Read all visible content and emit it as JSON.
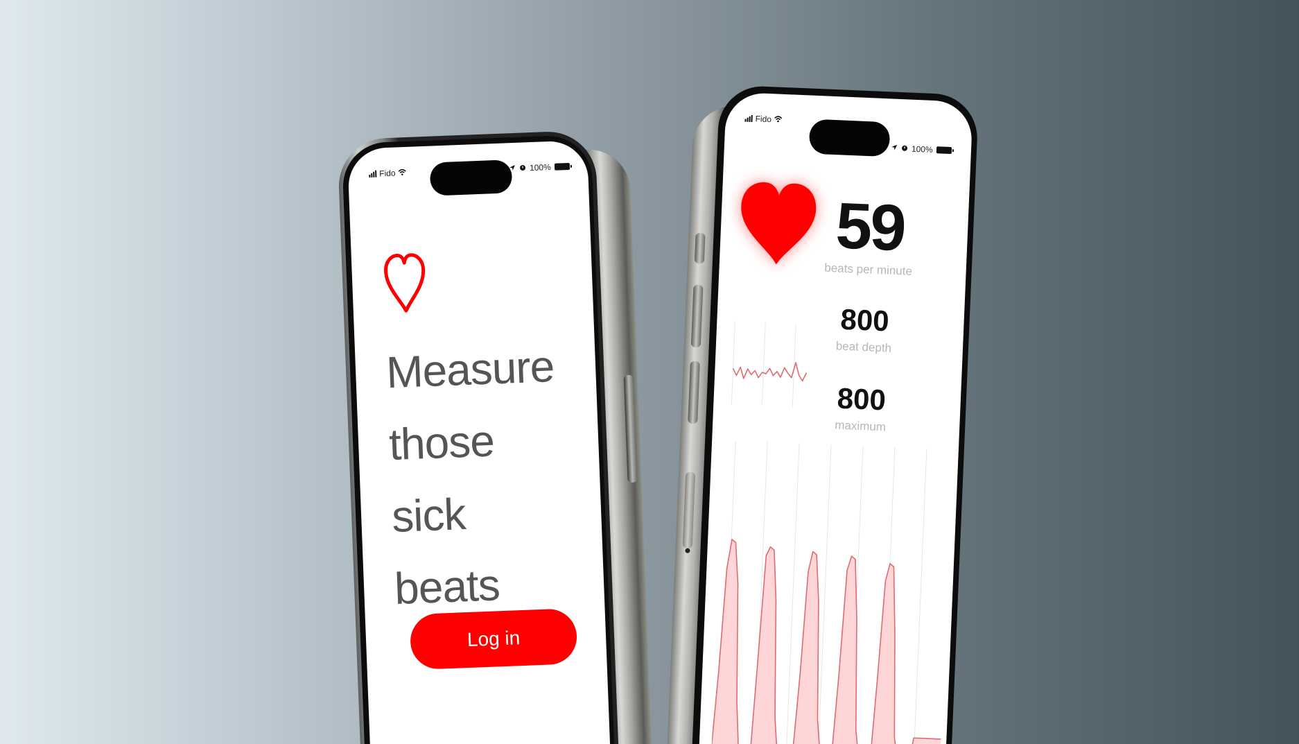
{
  "status_bar": {
    "carrier": "Fido",
    "battery": "100%",
    "icons": [
      "signal-icon",
      "wifi-icon",
      "location-icon",
      "alarm-icon",
      "battery-icon"
    ]
  },
  "left_screen": {
    "headline": [
      "Measure",
      "those",
      "sick",
      "beats"
    ],
    "login_label": "Log in",
    "icons": [
      "heart-outline-icon"
    ]
  },
  "right_screen": {
    "bpm": {
      "value": "59",
      "label": "beats per minute"
    },
    "depth": {
      "value": "800",
      "label": "beat depth"
    },
    "maximum": {
      "value": "800",
      "label": "maximum"
    },
    "icons": [
      "heart-filled-icon"
    ]
  },
  "colors": {
    "accent": "#ff0000",
    "chart_fill": "#ffd6d8",
    "chart_line": "#e06a70",
    "grid": "#e6e6e6"
  },
  "chart_data": [
    {
      "type": "line",
      "x": [
        0,
        1,
        2,
        3,
        4,
        5,
        6,
        7,
        8,
        9,
        10,
        11,
        12,
        13,
        14,
        15,
        16,
        17,
        18,
        19,
        20
      ],
      "values": [
        0.55,
        0.3,
        0.6,
        0.2,
        0.55,
        0.35,
        0.5,
        0.25,
        0.45,
        0.4,
        0.6,
        0.35,
        0.5,
        0.3,
        0.65,
        0.45,
        0.3,
        0.85,
        0.4,
        0.2,
        0.5
      ]
    },
    {
      "type": "area",
      "x": [
        0,
        1,
        2,
        3,
        4,
        5,
        6,
        7,
        8,
        9,
        10,
        11,
        12,
        13,
        14,
        15,
        16,
        17,
        18,
        19,
        20,
        21,
        22,
        23,
        24,
        25,
        26,
        27,
        28,
        29,
        30,
        31,
        32,
        33,
        34,
        35,
        36,
        37,
        38,
        39,
        40,
        41,
        42,
        43,
        44,
        45,
        46,
        47,
        48,
        49,
        50,
        51,
        52,
        53,
        54,
        55,
        56,
        57,
        58,
        59
      ],
      "values": [
        0.05,
        0.3,
        0.65,
        0.75,
        0.74,
        0.6,
        0.2,
        0.02,
        0.0,
        0.05,
        0.02,
        0.35,
        0.7,
        0.73,
        0.72,
        0.55,
        0.15,
        0.02,
        0.0,
        0.0,
        0.02,
        0.05,
        0.3,
        0.65,
        0.72,
        0.71,
        0.55,
        0.15,
        0.03,
        0.0,
        0.0,
        0.03,
        0.3,
        0.66,
        0.71,
        0.7,
        0.5,
        0.12,
        0.02,
        0.0,
        0.0,
        0.02,
        0.3,
        0.63,
        0.69,
        0.68,
        0.45,
        0.1,
        0.02,
        0.0,
        0.0,
        0.02,
        0.1,
        0.1,
        0.1,
        0.1,
        0.1,
        0.1,
        0.1,
        0.1
      ]
    }
  ]
}
